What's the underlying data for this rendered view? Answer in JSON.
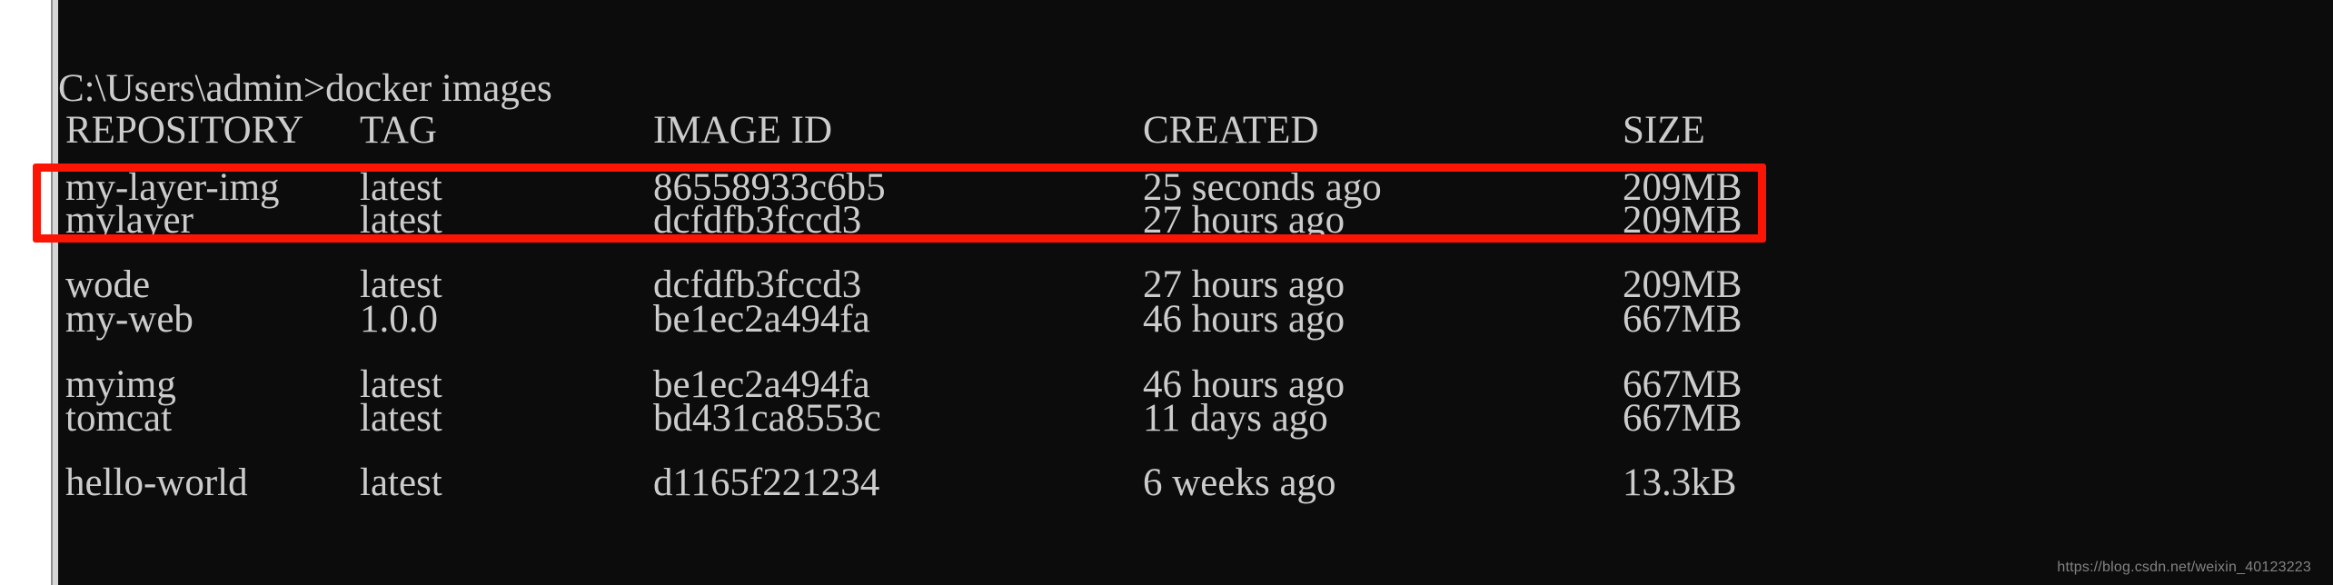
{
  "terminal": {
    "clipped_top_line": "",
    "prompt_line": "C:\\Users\\admin>docker images",
    "columns": {
      "repository": "REPOSITORY",
      "tag": "TAG",
      "image_id": "IMAGE ID",
      "created": "CREATED",
      "size": "SIZE"
    },
    "rows": [
      {
        "repository": "my-layer-img",
        "tag": "latest",
        "image_id": "86558933c6b5",
        "created": "25 seconds ago",
        "size": "209MB",
        "highlighted": true
      },
      {
        "repository": "mylayer",
        "tag": "latest",
        "image_id": "dcfdfb3fccd3",
        "created": "27 hours ago",
        "size": "209MB",
        "highlighted": false
      },
      {
        "repository": "wode",
        "tag": "latest",
        "image_id": "dcfdfb3fccd3",
        "created": "27 hours ago",
        "size": "209MB",
        "highlighted": false
      },
      {
        "repository": "my-web",
        "tag": "1.0.0",
        "image_id": "be1ec2a494fa",
        "created": "46 hours ago",
        "size": "667MB",
        "highlighted": false
      },
      {
        "repository": "myimg",
        "tag": "latest",
        "image_id": "be1ec2a494fa",
        "created": "46 hours ago",
        "size": "667MB",
        "highlighted": false
      },
      {
        "repository": "tomcat",
        "tag": "latest",
        "image_id": "bd431ca8553c",
        "created": "11 days ago",
        "size": "667MB",
        "highlighted": false
      },
      {
        "repository": "hello-world",
        "tag": "latest",
        "image_id": "d1165f221234",
        "created": "6 weeks ago",
        "size": "13.3kB",
        "highlighted": false
      }
    ]
  },
  "annotation": {
    "highlight_color": "#fc1505",
    "highlight_target_row": "my-layer-img"
  },
  "watermark": {
    "text": "https://blog.csdn.net/weixin_40123223"
  },
  "theme": {
    "console_background": "#0c0c0c",
    "console_foreground": "#cccccc",
    "page_background": "#ffffff",
    "window_edge": "#d6d6d6"
  }
}
